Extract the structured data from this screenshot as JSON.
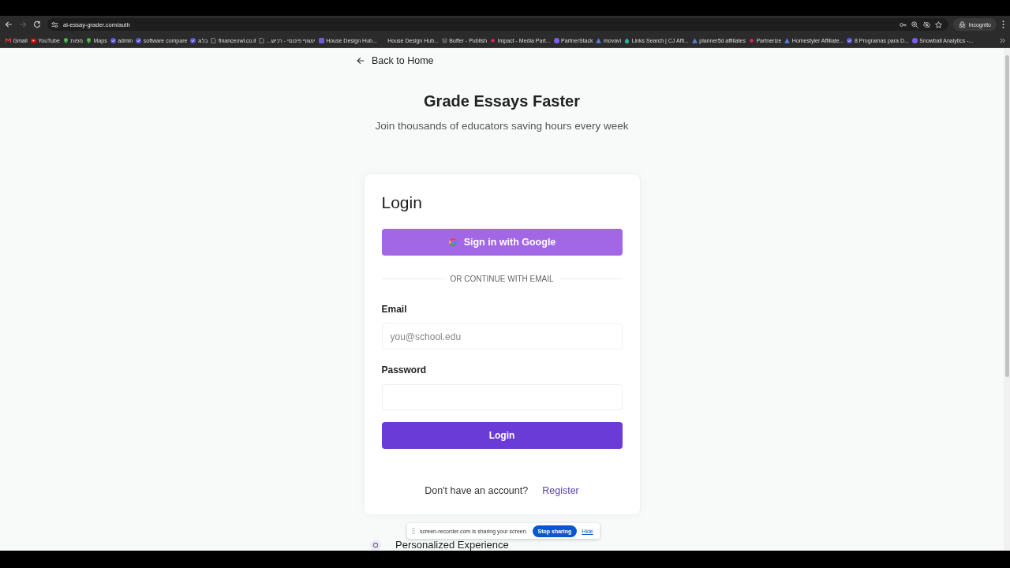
{
  "browser": {
    "nav_buttons": [
      {
        "kind": "back",
        "disabled": false
      },
      {
        "kind": "forward",
        "disabled": true
      },
      {
        "kind": "reload",
        "disabled": false
      }
    ],
    "url": "ai-essay-grader.com/auth",
    "profile_label": "Incognito"
  },
  "bookmarks": [
    {
      "label": "Gmail",
      "kind": "mail"
    },
    {
      "label": "YouTube",
      "kind": "video"
    },
    {
      "label": "מפות",
      "kind": "pin"
    },
    {
      "label": "Maps",
      "kind": "pin"
    },
    {
      "label": "admin",
      "kind": "check"
    },
    {
      "label": "software compare",
      "kind": "check"
    },
    {
      "label": "בלוג",
      "kind": "check"
    },
    {
      "label": "financeowl.co.il",
      "kind": "page"
    },
    {
      "label": "ינשוף פיננסי - רכיש...",
      "kind": "page"
    },
    {
      "label": "House Design Hub...",
      "kind": "square"
    },
    {
      "label": "House Design Hub...",
      "kind": "blank"
    },
    {
      "label": "Buffer - Publish",
      "kind": "stack"
    },
    {
      "label": "Impact - Media Part...",
      "kind": "dot"
    },
    {
      "label": "PartnerStack",
      "kind": "circle"
    },
    {
      "label": "movavi",
      "kind": "triangle"
    },
    {
      "label": "Links Search | CJ Affi...",
      "kind": "drop"
    },
    {
      "label": "planner5d affiliates",
      "kind": "triangle"
    },
    {
      "label": "Partnerize",
      "kind": "dot"
    },
    {
      "label": "Homestyler Affiliate...",
      "kind": "triangle"
    },
    {
      "label": "8 Programas para D...",
      "kind": "check"
    },
    {
      "label": "Snowball Analytics -...",
      "kind": "circle"
    }
  ],
  "page": {
    "back_link": "Back to Home",
    "title": "Grade Essays Faster",
    "subtitle": "Join thousands of educators saving hours every week",
    "login_card": {
      "heading": "Login",
      "google_button": "Sign in with Google",
      "divider": "OR CONTINUE WITH EMAIL",
      "fields": [
        {
          "label": "Email",
          "placeholder": "you@school.edu"
        },
        {
          "label": "Password"
        }
      ],
      "submit_button": "Login",
      "register_prompt": "Don't have an account?",
      "register_link": "Register"
    },
    "features": [
      {
        "title": "Personalized Experience"
      }
    ]
  },
  "share_notice": {
    "message": "screen-recorder.com is sharing your screen.",
    "stop_button": "Stop sharing",
    "hide_link": "Hide"
  }
}
